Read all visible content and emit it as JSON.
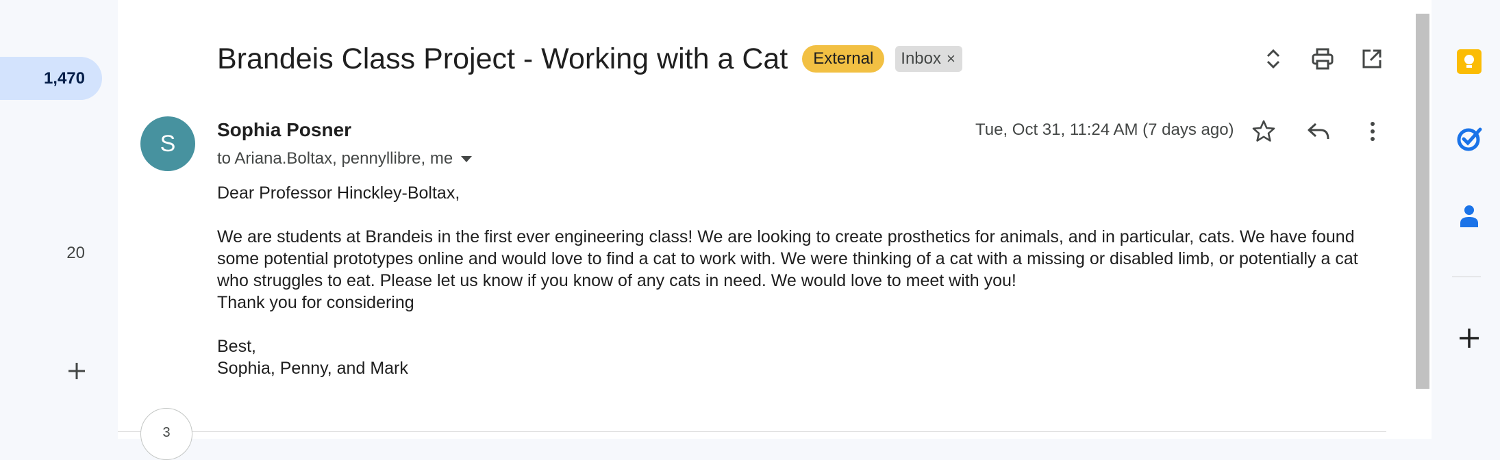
{
  "left_nav": {
    "active_count": "1,470",
    "secondary_count": "20",
    "add_icon": "plus-icon"
  },
  "message": {
    "subject": "Brandeis Class Project - Working with a Cat",
    "labels": {
      "external": "External",
      "inbox": "Inbox",
      "inbox_remove": "×"
    },
    "toolbar_icons": [
      "expand-collapse-icon",
      "print-icon",
      "open-in-new-window-icon"
    ],
    "sender": {
      "avatar_letter": "S",
      "name": "Sophia Posner",
      "recipients": "to Ariana.Boltax, pennyllibre, me"
    },
    "date": "Tue, Oct 31, 11:24 AM (7 days ago)",
    "actions": [
      "star-icon",
      "reply-icon",
      "more-options-icon"
    ],
    "body": {
      "greeting": "Dear Professor Hinckley-Boltax,",
      "paragraph_1": "We are students at Brandeis in the first ever engineering class! We are looking to create prosthetics for animals, and in particular, cats. We have found some potential prototypes online and would love to find a cat to work with. We were thinking of a cat with a missing or disabled limb, or potentially a cat who struggles to eat. Please let us know if you know of any cats in need. We would love to meet with you!",
      "thanks": "Thank you for considering",
      "closing": "Best,",
      "signature": "Sophia, Penny, and Mark"
    },
    "collapsed_count": "3"
  },
  "side_panel": {
    "icons": [
      "keep-icon",
      "tasks-icon",
      "contacts-icon",
      "add-addon-icon"
    ]
  },
  "colors": {
    "external_badge": "#f2c043",
    "active_pill": "#d3e3fd",
    "avatar": "#47929f",
    "keep": "#fbbc04",
    "tasks": "#1a73e8",
    "contacts": "#1a73e8"
  }
}
